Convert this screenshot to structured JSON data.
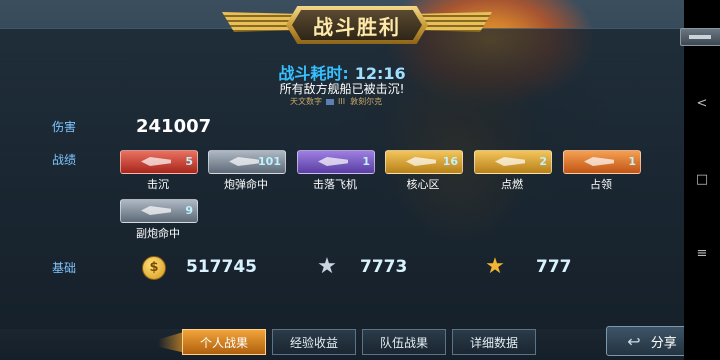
{
  "banner": {
    "title": "战斗胜利"
  },
  "battle": {
    "time_label": "战斗耗时:",
    "time_value": "12:16",
    "result_msg": "所有敌方舰船已被击沉!",
    "ship_a": "天文数字",
    "ship_rank": "III",
    "ship_b": "敦刻尔克"
  },
  "stats": {
    "damage_label": "伤害",
    "damage_value": "241007",
    "record_label": "战绩",
    "medals": [
      {
        "name": "击沉",
        "count": "5",
        "color": "#c23a2e"
      },
      {
        "name": "炮弹命中",
        "count": "101",
        "color": "#7d8896"
      },
      {
        "name": "击落飞机",
        "count": "1",
        "color": "#6f51bf"
      },
      {
        "name": "核心区",
        "count": "16",
        "color": "#d69d2c"
      },
      {
        "name": "点燃",
        "count": "2",
        "color": "#d69d2c"
      },
      {
        "name": "占领",
        "count": "1",
        "color": "#e07428"
      },
      {
        "name": "副炮命中",
        "count": "9",
        "color": "#7d8896"
      }
    ],
    "base_label": "基础",
    "coins": "517745",
    "xp": "7773",
    "free_xp": "777"
  },
  "tabs": [
    "个人战果",
    "经验收益",
    "队伍战果",
    "详细数据"
  ],
  "active_tab": 0,
  "share_label": "分享",
  "icons": {
    "coin": "coin-icon",
    "xp": "silver-star-icon",
    "free_xp": "gold-star-icon",
    "share": "share-arrow-icon"
  }
}
